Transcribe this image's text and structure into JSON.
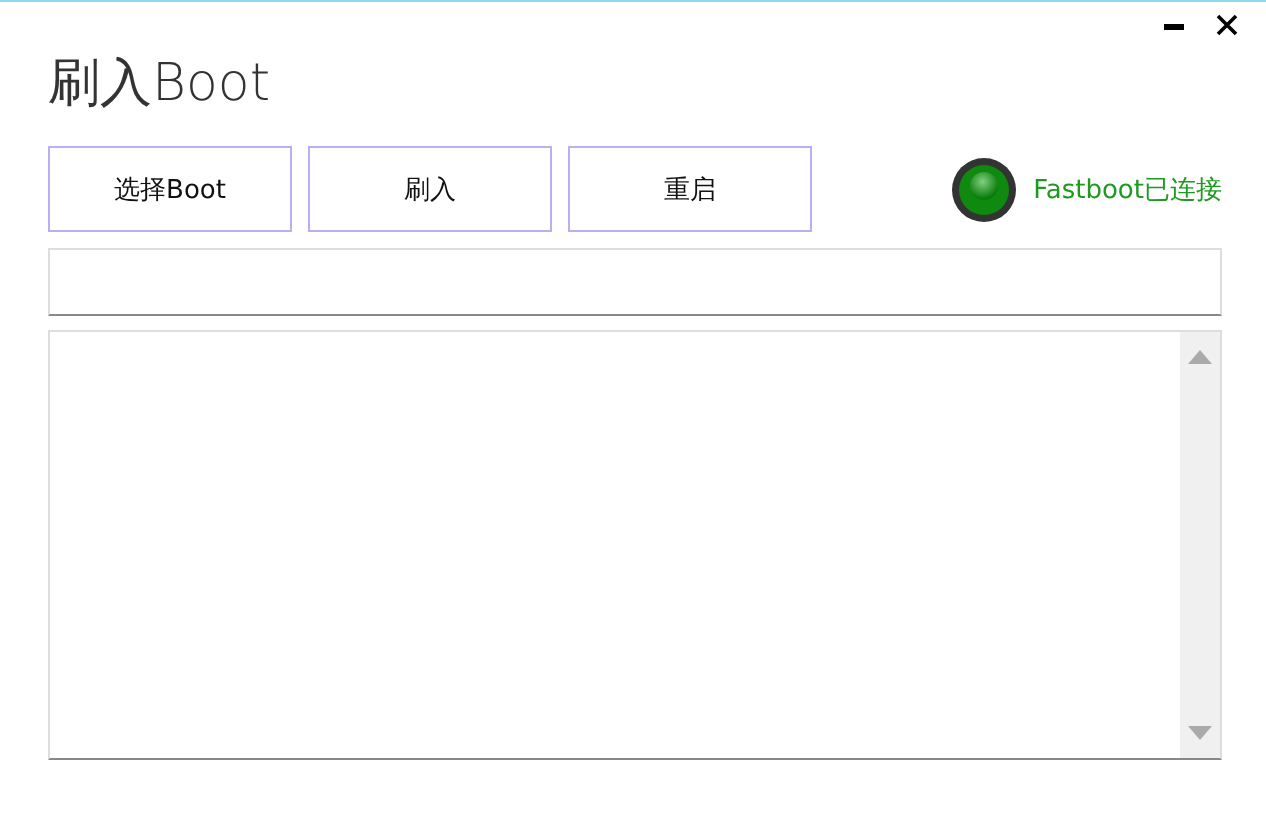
{
  "window": {
    "title": "刷入Boot"
  },
  "buttons": [
    {
      "label": "选择Boot"
    },
    {
      "label": "刷入"
    },
    {
      "label": "重启"
    }
  ],
  "status": {
    "label": "Fastboot已连接",
    "connected": true
  }
}
